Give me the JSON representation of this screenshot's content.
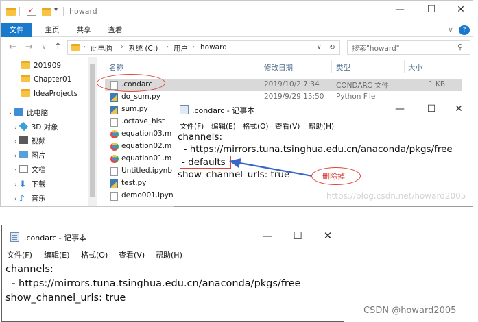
{
  "explorer": {
    "title": "howard",
    "window_controls": {
      "minimize": "—",
      "maximize": "☐",
      "close": "✕"
    },
    "ribbon": {
      "tabs": [
        "文件",
        "主页",
        "共享",
        "查看"
      ],
      "expand": "∨",
      "help": "?"
    },
    "address": {
      "nav": {
        "back": "←",
        "forward": "→",
        "recent": "∨",
        "up": "↑"
      },
      "breadcrumb": [
        "此电脑",
        "系统 (C:)",
        "用户",
        "howard"
      ],
      "separator": "›",
      "dropdown": "∨",
      "refresh": "↻",
      "search_placeholder": "搜索\"howard\""
    },
    "nav_pane": {
      "items": [
        {
          "label": "201909",
          "icon": "folder-icon"
        },
        {
          "label": "Chapter01",
          "icon": "folder-icon"
        },
        {
          "label": "IdeaProjects",
          "icon": "folder-icon"
        },
        {
          "label": "此电脑",
          "icon": "computer-icon"
        },
        {
          "label": "3D 对象",
          "icon": "3d-objects-icon"
        },
        {
          "label": "视频",
          "icon": "video-icon"
        },
        {
          "label": "图片",
          "icon": "pictures-icon"
        },
        {
          "label": "文档",
          "icon": "documents-icon"
        },
        {
          "label": "下载",
          "icon": "download-icon"
        },
        {
          "label": "音乐",
          "icon": "music-icon"
        }
      ]
    },
    "columns": {
      "name": "名称",
      "date": "修改日期",
      "type": "类型",
      "size": "大小"
    },
    "files": [
      {
        "name": ".condarc",
        "date": "2019/10/2 7:34",
        "type": "CONDARC 文件",
        "size": "1 KB",
        "icon": "file-icon"
      },
      {
        "name": "do_sum.py",
        "date": "2019/9/29 15:50",
        "type": "Python File",
        "size": "",
        "icon": "python-file-icon"
      },
      {
        "name": "sum.py",
        "date": "",
        "type": "",
        "size": "",
        "icon": "python-file-icon"
      },
      {
        "name": ".octave_hist",
        "date": "",
        "type": "",
        "size": "",
        "icon": "file-icon"
      },
      {
        "name": "equation03.m",
        "date": "",
        "type": "",
        "size": "",
        "icon": "chrome-file-icon"
      },
      {
        "name": "equation02.m",
        "date": "",
        "type": "",
        "size": "",
        "icon": "chrome-file-icon"
      },
      {
        "name": "equation01.m",
        "date": "",
        "type": "",
        "size": "",
        "icon": "chrome-file-icon"
      },
      {
        "name": "Untitled.ipynb",
        "date": "",
        "type": "",
        "size": "",
        "icon": "notebook-file-icon"
      },
      {
        "name": "test.py",
        "date": "",
        "type": "",
        "size": "",
        "icon": "python-file-icon"
      },
      {
        "name": "demo001.ipynb",
        "date": "",
        "type": "",
        "size": "",
        "icon": "notebook-file-icon"
      }
    ]
  },
  "notepad_top": {
    "title": ".condarc - 记事本",
    "window_controls": {
      "minimize": "—",
      "maximize": "☐",
      "close": "✕"
    },
    "menu": [
      "文件(F)",
      "编辑(E)",
      "格式(O)",
      "查看(V)",
      "帮助(H)"
    ],
    "lines": [
      "channels:",
      "  - https://mirrors.tuna.tsinghua.edu.cn/anaconda/pkgs/free",
      "- defaults",
      "show_channel_urls: true"
    ],
    "watermark": "https://blog.csdn.net/howard2005"
  },
  "annotation": {
    "callout_text": "删除掉",
    "accent_color": "#e0433a"
  },
  "notepad_bottom": {
    "title": ".condarc - 记事本",
    "window_controls": {
      "minimize": "—",
      "maximize": "☐",
      "close": "✕"
    },
    "menu": [
      "文件(F)",
      "编辑(E)",
      "格式(O)",
      "查看(V)",
      "帮助(H)"
    ],
    "lines": [
      "channels:",
      "  - https://mirrors.tuna.tsinghua.edu.cn/anaconda/pkgs/free",
      "show_channel_urls: true"
    ]
  },
  "footer": {
    "watermark": "CSDN @howard2005"
  },
  "colors": {
    "ribbon_file_tab": "#1979ca",
    "selection_row": "#d9d9d9",
    "annotation_red": "#e0433a",
    "arrow_blue": "#3a66c7"
  }
}
